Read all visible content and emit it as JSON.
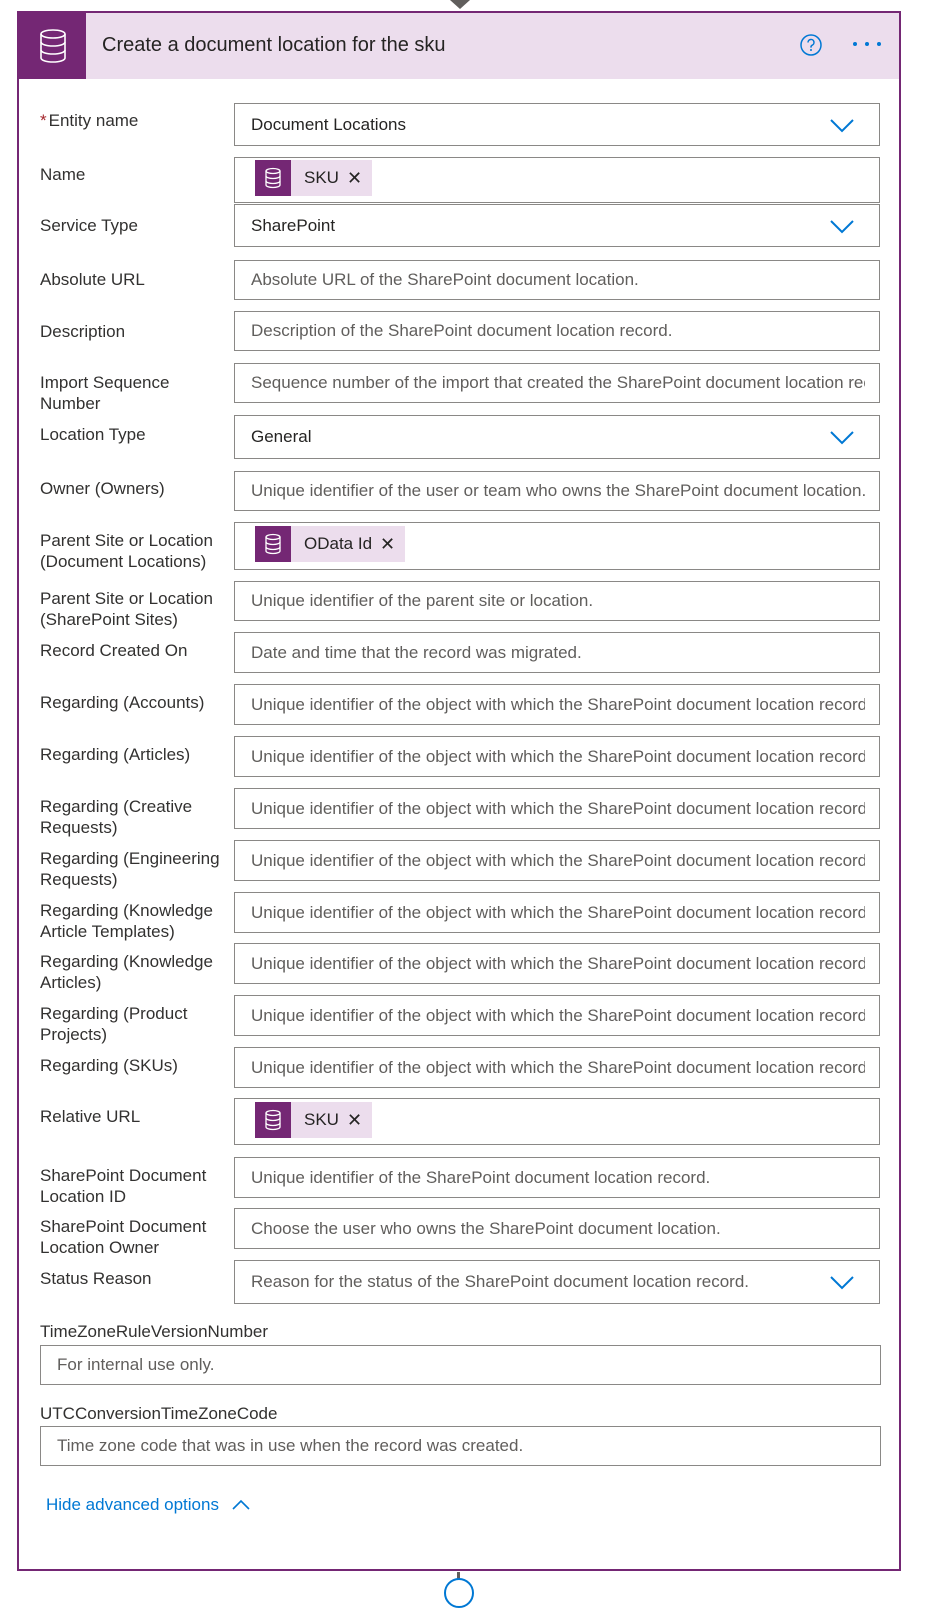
{
  "header": {
    "title": "Create a document location for the sku",
    "action_icon": "database-icon",
    "help_icon": "help-circle-icon",
    "more_icon": "more-icon"
  },
  "colors": {
    "accent": "#742774",
    "header_bg": "#ecdded",
    "link": "#0078d4"
  },
  "fields": {
    "entity_name": {
      "label": "Entity name",
      "required_mark": "*",
      "value": "Document Locations"
    },
    "name": {
      "label": "Name",
      "token": "SKU"
    },
    "service_type": {
      "label": "Service Type",
      "value": "SharePoint"
    },
    "absolute_url": {
      "label": "Absolute URL",
      "placeholder": "Absolute URL of the SharePoint document location."
    },
    "description": {
      "label": "Description",
      "placeholder": "Description of the SharePoint document location record."
    },
    "import_sequence_number": {
      "label": "Import Sequence Number",
      "placeholder": "Sequence number of the import that created the SharePoint document location record."
    },
    "location_type": {
      "label": "Location Type",
      "value": "General"
    },
    "owner": {
      "label": "Owner (Owners)",
      "placeholder": "Unique identifier of the user or team who owns the SharePoint document location."
    },
    "parent_doc_locations": {
      "label": "Parent Site or Location (Document Locations)",
      "token": "OData Id"
    },
    "parent_sp_sites": {
      "label": "Parent Site or Location (SharePoint Sites)",
      "placeholder": "Unique identifier of the parent site or location."
    },
    "record_created_on": {
      "label": "Record Created On",
      "placeholder": "Date and time that the record was migrated."
    },
    "regarding_accounts": {
      "label": "Regarding (Accounts)",
      "placeholder": "Unique identifier of the object with which the SharePoint document location record is associated."
    },
    "regarding_articles": {
      "label": "Regarding (Articles)",
      "placeholder": "Unique identifier of the object with which the SharePoint document location record is associated."
    },
    "regarding_creative": {
      "label": "Regarding (Creative Requests)",
      "placeholder": "Unique identifier of the object with which the SharePoint document location record is associated."
    },
    "regarding_engineering": {
      "label": "Regarding (Engineering Requests)",
      "placeholder": "Unique identifier of the object with which the SharePoint document location record is associated."
    },
    "regarding_ka_templates": {
      "label": "Regarding (Knowledge Article Templates)",
      "placeholder": "Unique identifier of the object with which the SharePoint document location record is associated."
    },
    "regarding_ka": {
      "label": "Regarding (Knowledge Articles)",
      "placeholder": "Unique identifier of the object with which the SharePoint document location record is associated."
    },
    "regarding_product_projects": {
      "label": "Regarding (Product Projects)",
      "placeholder": "Unique identifier of the object with which the SharePoint document location record is associated."
    },
    "regarding_skus": {
      "label": "Regarding (SKUs)",
      "placeholder": "Unique identifier of the object with which the SharePoint document location record is associated."
    },
    "relative_url": {
      "label": "Relative URL",
      "token": "SKU"
    },
    "sp_doc_location_id": {
      "label": "SharePoint Document Location ID",
      "placeholder": "Unique identifier of the SharePoint document location record."
    },
    "sp_doc_location_owner": {
      "label": "SharePoint Document Location Owner",
      "placeholder": "Choose the user who owns the SharePoint document location."
    },
    "status_reason": {
      "label": "Status Reason",
      "placeholder": "Reason for the status of the SharePoint document location record."
    },
    "tz_rule_version": {
      "label": "TimeZoneRuleVersionNumber",
      "placeholder": "For internal use only."
    },
    "utc_conversion": {
      "label": "UTCConversionTimeZoneCode",
      "placeholder": "Time zone code that was in use when the record was created."
    }
  },
  "advanced": {
    "label": "Hide advanced options"
  }
}
